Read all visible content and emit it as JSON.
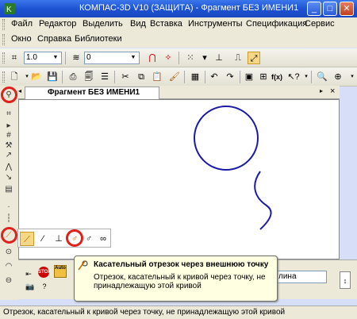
{
  "window": {
    "title": "КОМПАС-3D V10 (ЗАЩИТА) - Фрагмент БЕЗ ИМЕНИ1",
    "minimize": "_",
    "maximize": "□",
    "close": "✕"
  },
  "menu": {
    "row1": [
      "Файл",
      "Редактор",
      "Выделить",
      "Вид",
      "Вставка",
      "Инструменты",
      "Спецификация",
      "Сервис"
    ],
    "row2": [
      "Окно",
      "Справка",
      "Библиотеки"
    ]
  },
  "toolbar1": {
    "scale_value": "1.0",
    "layer_value": "0"
  },
  "document_tab": {
    "label": "Фрагмент БЕЗ ИМЕНИ1",
    "close": "×"
  },
  "tooltip": {
    "title": "Касательный отрезок через внешнюю точку",
    "body": "Отрезок, касательный к кривой через точку, не принадлежащую этой кривой"
  },
  "property_bar": {
    "length_label": "лина"
  },
  "statusbar": {
    "text": "Отрезок, касательный к кривой через точку, не принадлежащую этой кривой"
  },
  "colors": {
    "geometry": "#1a1aa6",
    "highlight_ring": "#e0201a",
    "titlebar": "#1d53d3"
  },
  "icons": [
    "app-icon",
    "new-icon",
    "open-icon",
    "save-icon",
    "print-icon",
    "cut-icon",
    "copy-icon",
    "paste-icon",
    "undo-icon",
    "redo-icon",
    "zoom-icon",
    "help-icon",
    "geometry-icon",
    "dimension-icon",
    "line-tool-icon",
    "tangent-segment-icon",
    "stop-icon",
    "auto-icon"
  ]
}
